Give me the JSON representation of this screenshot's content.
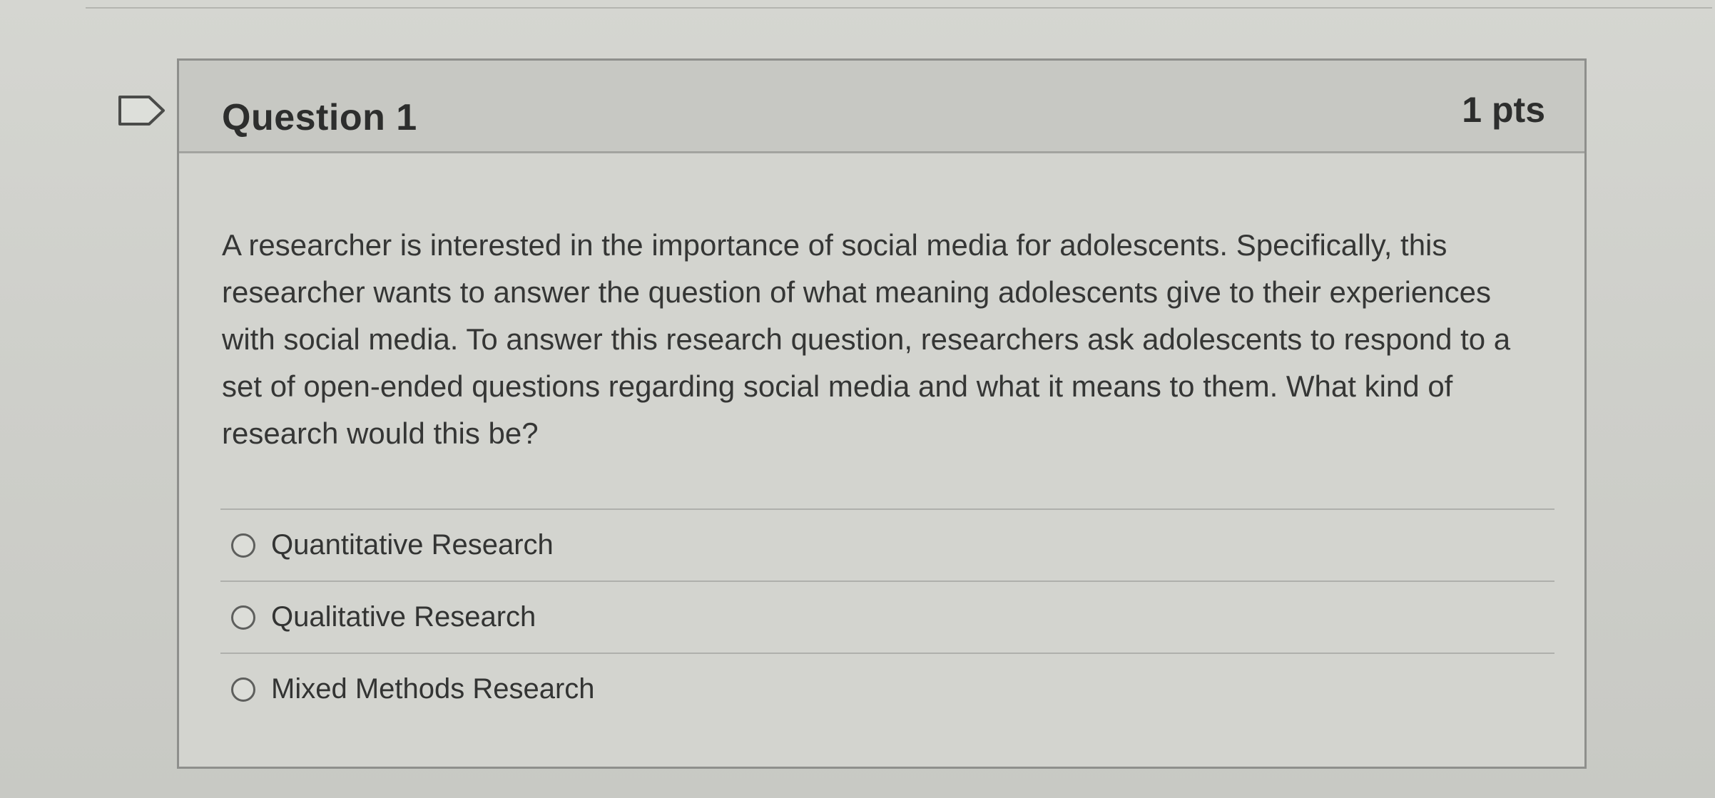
{
  "question": {
    "title": "Question 1",
    "points": "1 pts",
    "text": "A researcher is interested in the importance of social media for adolescents. Specifically, this researcher wants to answer the question of what meaning adolescents give to their experiences with social media. To answer this research question, researchers ask adolescents to respond to a set of open-ended questions regarding social media and what it means to them. What kind of research would this be?",
    "options": [
      {
        "label": "Quantitative Research",
        "selected": false
      },
      {
        "label": "Qualitative Research",
        "selected": false
      },
      {
        "label": "Mixed Methods Research",
        "selected": false
      }
    ]
  },
  "colors": {
    "header_bg": "#c7c8c3",
    "card_bg": "#d3d4cf",
    "page_bg": "#cfd0cb",
    "text": "#2d2e2d"
  },
  "icons": {
    "flag": "flag-outline-icon",
    "radio": "radio-unchecked-icon"
  }
}
